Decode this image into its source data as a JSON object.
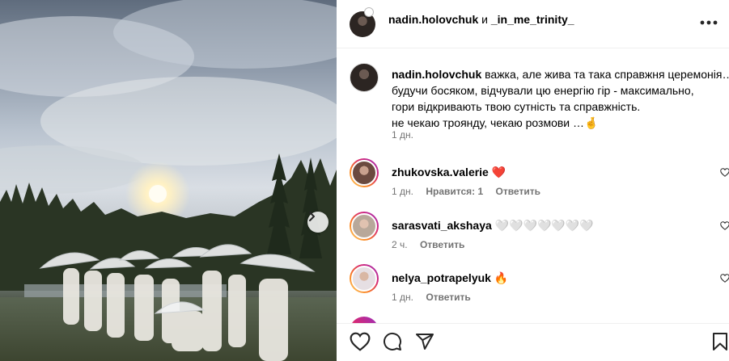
{
  "post_header": {
    "author": "nadin.holovchuk",
    "joiner": "и",
    "collaborator": "_in_me_trinity_",
    "more_icon": "more-horizontal-icon"
  },
  "caption": {
    "username": "nadin.holovchuk",
    "lines": [
      "важка, але жива та така справжня церемонія…",
      "будучи босяком, відчували цю енергію гір - максимально,",
      "гори відкривають твою сутність та справжність.",
      "не чекаю троянду, чекаю розмови …🤞"
    ],
    "time": "1 дн."
  },
  "comments": [
    {
      "username": "zhukovska.valerie",
      "text": "❤️",
      "time": "1 дн.",
      "likes": "Нравится: 1",
      "reply": "Ответить"
    },
    {
      "username": "sarasvati_akshaya",
      "text": "🤍🤍🤍🤍🤍🤍🤍",
      "time": "2 ч.",
      "likes": "",
      "reply": "Ответить"
    },
    {
      "username": "nelya_potrapelyuk",
      "text": "🔥",
      "time": "1 дн.",
      "likes": "",
      "reply": "Ответить"
    }
  ],
  "actions": {
    "like_icon": "heart-icon",
    "comment_icon": "comment-icon",
    "share_icon": "share-icon",
    "save_icon": "bookmark-icon"
  },
  "carousel": {
    "next_icon": "chevron-right-icon"
  }
}
